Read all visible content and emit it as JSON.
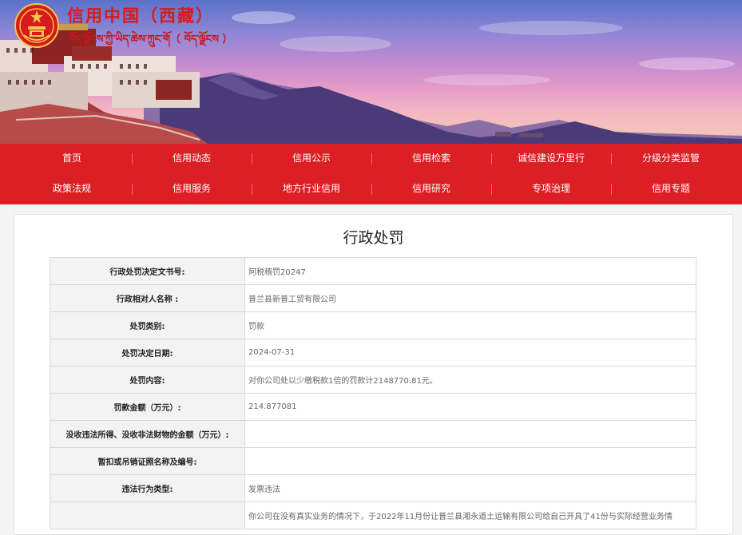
{
  "header": {
    "site_title": "信用中国（西藏）",
    "site_subtitle": "བོད་ལྗོངས་ཀྱི་ཡིད་ཆེས་ཀྲུང་གོ（ བོད་ལྗོངས ）",
    "emblem_icon": "national-emblem-icon",
    "brand_color": "#d8191d"
  },
  "nav": {
    "background": "#dc1f25",
    "row1": [
      "首页",
      "信用动态",
      "信用公示",
      "信用检索",
      "诚信建设万里行",
      "分级分类监管"
    ],
    "row2": [
      "政策法规",
      "信用服务",
      "地方行业信用",
      "信用研究",
      "专项治理",
      "信用专题"
    ]
  },
  "page": {
    "title": "行政处罚"
  },
  "record": {
    "rows": [
      {
        "label": "行政处罚决定文书号:",
        "value": "阿税稽罚20247"
      },
      {
        "label": "行政相对人名称 :",
        "value": "普兰县新普工贸有限公司"
      },
      {
        "label": "处罚类别:",
        "value": "罚款"
      },
      {
        "label": "处罚决定日期:",
        "value": "2024-07-31"
      },
      {
        "label": "处罚内容:",
        "value": "对你公司处以少缴税款1倍的罚款计2148770.81元。"
      },
      {
        "label": "罚款金额（万元）:",
        "value": "214.877081"
      },
      {
        "label": "没收违法所得、没收非法财物的金额（万元）:",
        "value": ""
      },
      {
        "label": "暂扣或吊销证照名称及编号:",
        "value": ""
      },
      {
        "label": "违法行为类型:",
        "value": "发票违法"
      },
      {
        "label": "",
        "value": "你公司在没有真实业务的情况下，于2022年11月份让普兰县湘永道土运输有限公司给自己开具了41份与实际经营业务情"
      }
    ]
  }
}
